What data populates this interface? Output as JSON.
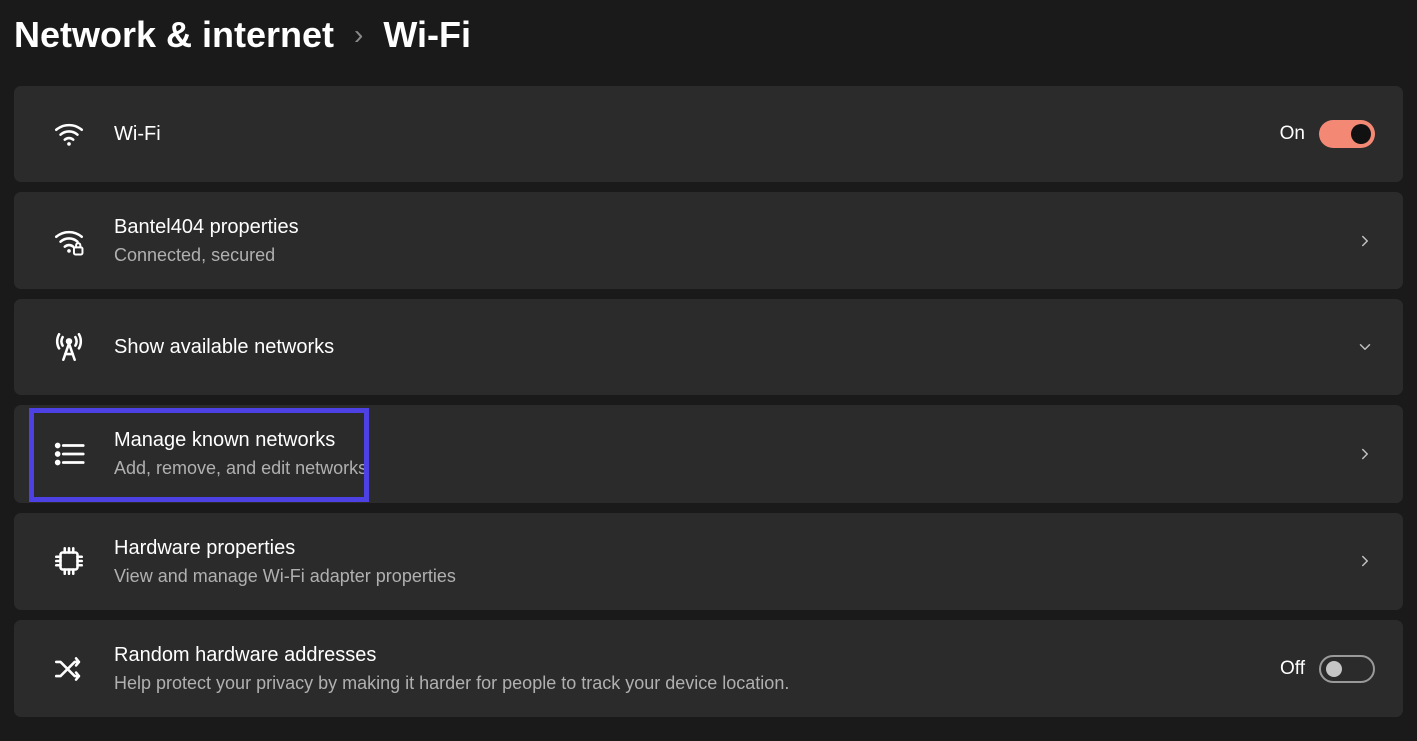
{
  "breadcrumb": {
    "parent": "Network & internet",
    "separator": "›",
    "current": "Wi-Fi"
  },
  "wifi_toggle": {
    "title": "Wi-Fi",
    "state_label": "On",
    "on": true
  },
  "network_properties": {
    "title": "Bantel404 properties",
    "subtitle": "Connected, secured"
  },
  "available_networks": {
    "title": "Show available networks"
  },
  "known_networks": {
    "title": "Manage known networks",
    "subtitle": "Add, remove, and edit networks"
  },
  "hardware_properties": {
    "title": "Hardware properties",
    "subtitle": "View and manage Wi-Fi adapter properties"
  },
  "random_addresses": {
    "title": "Random hardware addresses",
    "subtitle": "Help protect your privacy by making it harder for people to track your device location.",
    "state_label": "Off",
    "on": false
  },
  "colors": {
    "toggle_on": "#f38974",
    "highlight": "#4e41e3"
  }
}
